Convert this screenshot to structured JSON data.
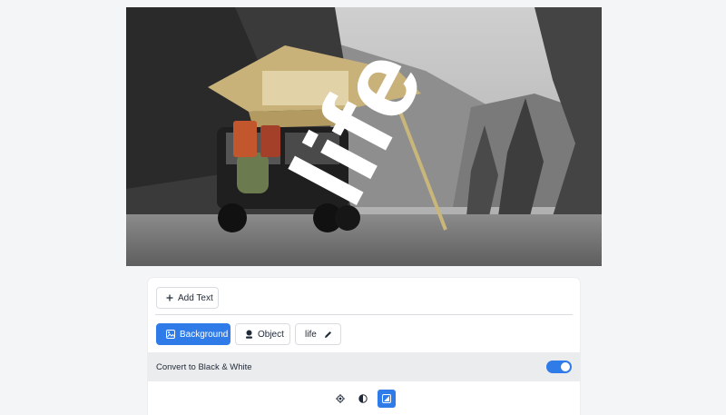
{
  "photo": {
    "overlay_text": "life",
    "description_icon": "car-camping-photo"
  },
  "toolbar": {
    "add_text_label": "Add Text",
    "add_icon": "plus-icon"
  },
  "layers": {
    "background_label": "Background",
    "object_label": "Object",
    "text_layer_label": "life"
  },
  "settings": {
    "bw_label": "Convert to Black & White",
    "bw_enabled": true
  },
  "modes": [
    {
      "name": "focus-mode",
      "icon": "target-icon",
      "active": false
    },
    {
      "name": "contrast-mode",
      "icon": "contrast-icon",
      "active": false
    },
    {
      "name": "portrait-mode",
      "icon": "image-icon",
      "active": true
    }
  ],
  "colors": {
    "accent": "#2f7be8",
    "panel_bg": "#ffffff",
    "row_bg": "#ebecee"
  }
}
